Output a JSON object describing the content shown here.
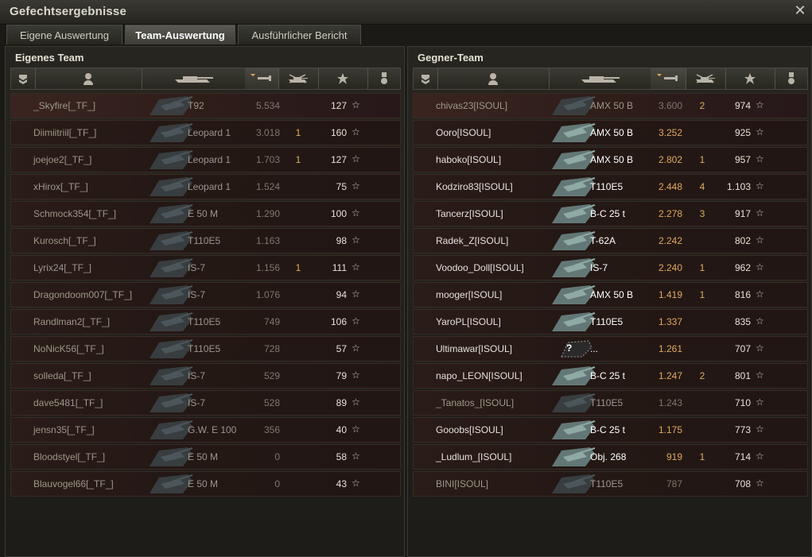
{
  "window": {
    "title": "Gefechtsergebnisse",
    "close": "✕"
  },
  "tabs": [
    {
      "label": "Eigene Auswertung",
      "active": false
    },
    {
      "label": "Team-Auswertung",
      "active": true
    },
    {
      "label": "Ausführlicher Bericht",
      "active": false
    }
  ],
  "colors": {
    "accent": "#e0a860",
    "alive_text": "#ffffff",
    "dead_text": "#9c9789",
    "row_bg": "#241815"
  },
  "own_team": {
    "title": "Eigenes Team",
    "icons": [
      "squad-icon",
      "player-icon",
      "tank-icon",
      "damage-icon",
      "kills-icon",
      "xp-star-icon",
      "medal-icon"
    ],
    "rows": [
      {
        "name": "_Skyfire[_TF_]",
        "vehicle": "T92",
        "damage": "5.534",
        "kills": "",
        "xp": "127",
        "alive": false
      },
      {
        "name": "Diimiitriil[_TF_]",
        "vehicle": "Leopard 1",
        "damage": "3.018",
        "kills": "1",
        "xp": "160",
        "alive": false
      },
      {
        "name": "joejoe2[_TF_]",
        "vehicle": "Leopard 1",
        "damage": "1.703",
        "kills": "1",
        "xp": "127",
        "alive": false
      },
      {
        "name": "xHirox[_TF_]",
        "vehicle": "Leopard 1",
        "damage": "1.524",
        "kills": "",
        "xp": "75",
        "alive": false
      },
      {
        "name": "Schmock354[_TF_]",
        "vehicle": "E 50 M",
        "damage": "1.290",
        "kills": "",
        "xp": "100",
        "alive": false
      },
      {
        "name": "Kurosch[_TF_]",
        "vehicle": "T110E5",
        "damage": "1.163",
        "kills": "",
        "xp": "98",
        "alive": false
      },
      {
        "name": "Lyrix24[_TF_]",
        "vehicle": "IS-7",
        "damage": "1.156",
        "kills": "1",
        "xp": "111",
        "alive": false
      },
      {
        "name": "Dragondoom007[_TF_]",
        "vehicle": "IS-7",
        "damage": "1.076",
        "kills": "",
        "xp": "94",
        "alive": false
      },
      {
        "name": "Randlman2[_TF_]",
        "vehicle": "T110E5",
        "damage": "749",
        "kills": "",
        "xp": "106",
        "alive": false
      },
      {
        "name": "NoNicK56[_TF_]",
        "vehicle": "T110E5",
        "damage": "728",
        "kills": "",
        "xp": "57",
        "alive": false
      },
      {
        "name": "solleda[_TF_]",
        "vehicle": "IS-7",
        "damage": "529",
        "kills": "",
        "xp": "79",
        "alive": false
      },
      {
        "name": "dave5481[_TF_]",
        "vehicle": "IS-7",
        "damage": "528",
        "kills": "",
        "xp": "89",
        "alive": false
      },
      {
        "name": "jensn35[_TF_]",
        "vehicle": "G.W. E 100",
        "damage": "356",
        "kills": "",
        "xp": "40",
        "alive": false
      },
      {
        "name": "Bloodstyel[_TF_]",
        "vehicle": "E 50 M",
        "damage": "0",
        "kills": "",
        "xp": "58",
        "alive": false
      },
      {
        "name": "Blauvogel66[_TF_]",
        "vehicle": "E 50 M",
        "damage": "0",
        "kills": "",
        "xp": "43",
        "alive": false
      }
    ]
  },
  "enemy_team": {
    "title": "Gegner-Team",
    "rows": [
      {
        "name": "chivas23[ISOUL]",
        "vehicle": "AMX 50 B",
        "damage": "3.600",
        "kills": "2",
        "xp": "974",
        "alive": false
      },
      {
        "name": "Ooro[ISOUL]",
        "vehicle": "AMX 50 B",
        "damage": "3.252",
        "kills": "",
        "xp": "925",
        "alive": true
      },
      {
        "name": "haboko[ISOUL]",
        "vehicle": "AMX 50 B",
        "damage": "2.802",
        "kills": "1",
        "xp": "957",
        "alive": true
      },
      {
        "name": "Kodziro83[ISOUL]",
        "vehicle": "T110E5",
        "damage": "2.448",
        "kills": "4",
        "xp": "1.103",
        "alive": true
      },
      {
        "name": "Tancerz[ISOUL]",
        "vehicle": "B-C 25 t",
        "damage": "2.278",
        "kills": "3",
        "xp": "917",
        "alive": true
      },
      {
        "name": "Radek_Z[ISOUL]",
        "vehicle": "T-62A",
        "damage": "2.242",
        "kills": "",
        "xp": "802",
        "alive": true
      },
      {
        "name": "Voodoo_Doll[ISOUL]",
        "vehicle": "IS-7",
        "damage": "2.240",
        "kills": "1",
        "xp": "962",
        "alive": true
      },
      {
        "name": "mooger[ISOUL]",
        "vehicle": "AMX 50 B",
        "damage": "1.419",
        "kills": "1",
        "xp": "816",
        "alive": true
      },
      {
        "name": "YaroPL[ISOUL]",
        "vehicle": "T110E5",
        "damage": "1.337",
        "kills": "",
        "xp": "835",
        "alive": true
      },
      {
        "name": "Ultimawar[ISOUL]",
        "vehicle": "...",
        "damage": "1.261",
        "kills": "",
        "xp": "707",
        "alive": true,
        "unknown": true
      },
      {
        "name": "napo_LEON[ISOUL]",
        "vehicle": "B-C 25 t",
        "damage": "1.247",
        "kills": "2",
        "xp": "801",
        "alive": true
      },
      {
        "name": "_Tanatos_[ISOUL]",
        "vehicle": "T110E5",
        "damage": "1.243",
        "kills": "",
        "xp": "710",
        "alive": false
      },
      {
        "name": "Gooobs[ISOUL]",
        "vehicle": "B-C 25 t",
        "damage": "1.175",
        "kills": "",
        "xp": "773",
        "alive": true
      },
      {
        "name": "_Ludlum_[ISOUL]",
        "vehicle": "Obj. 268",
        "damage": "919",
        "kills": "1",
        "xp": "714",
        "alive": true
      },
      {
        "name": "BINI[ISOUL]",
        "vehicle": "T110E5",
        "damage": "787",
        "kills": "",
        "xp": "708",
        "alive": false
      }
    ]
  },
  "star_glyph": "☆"
}
